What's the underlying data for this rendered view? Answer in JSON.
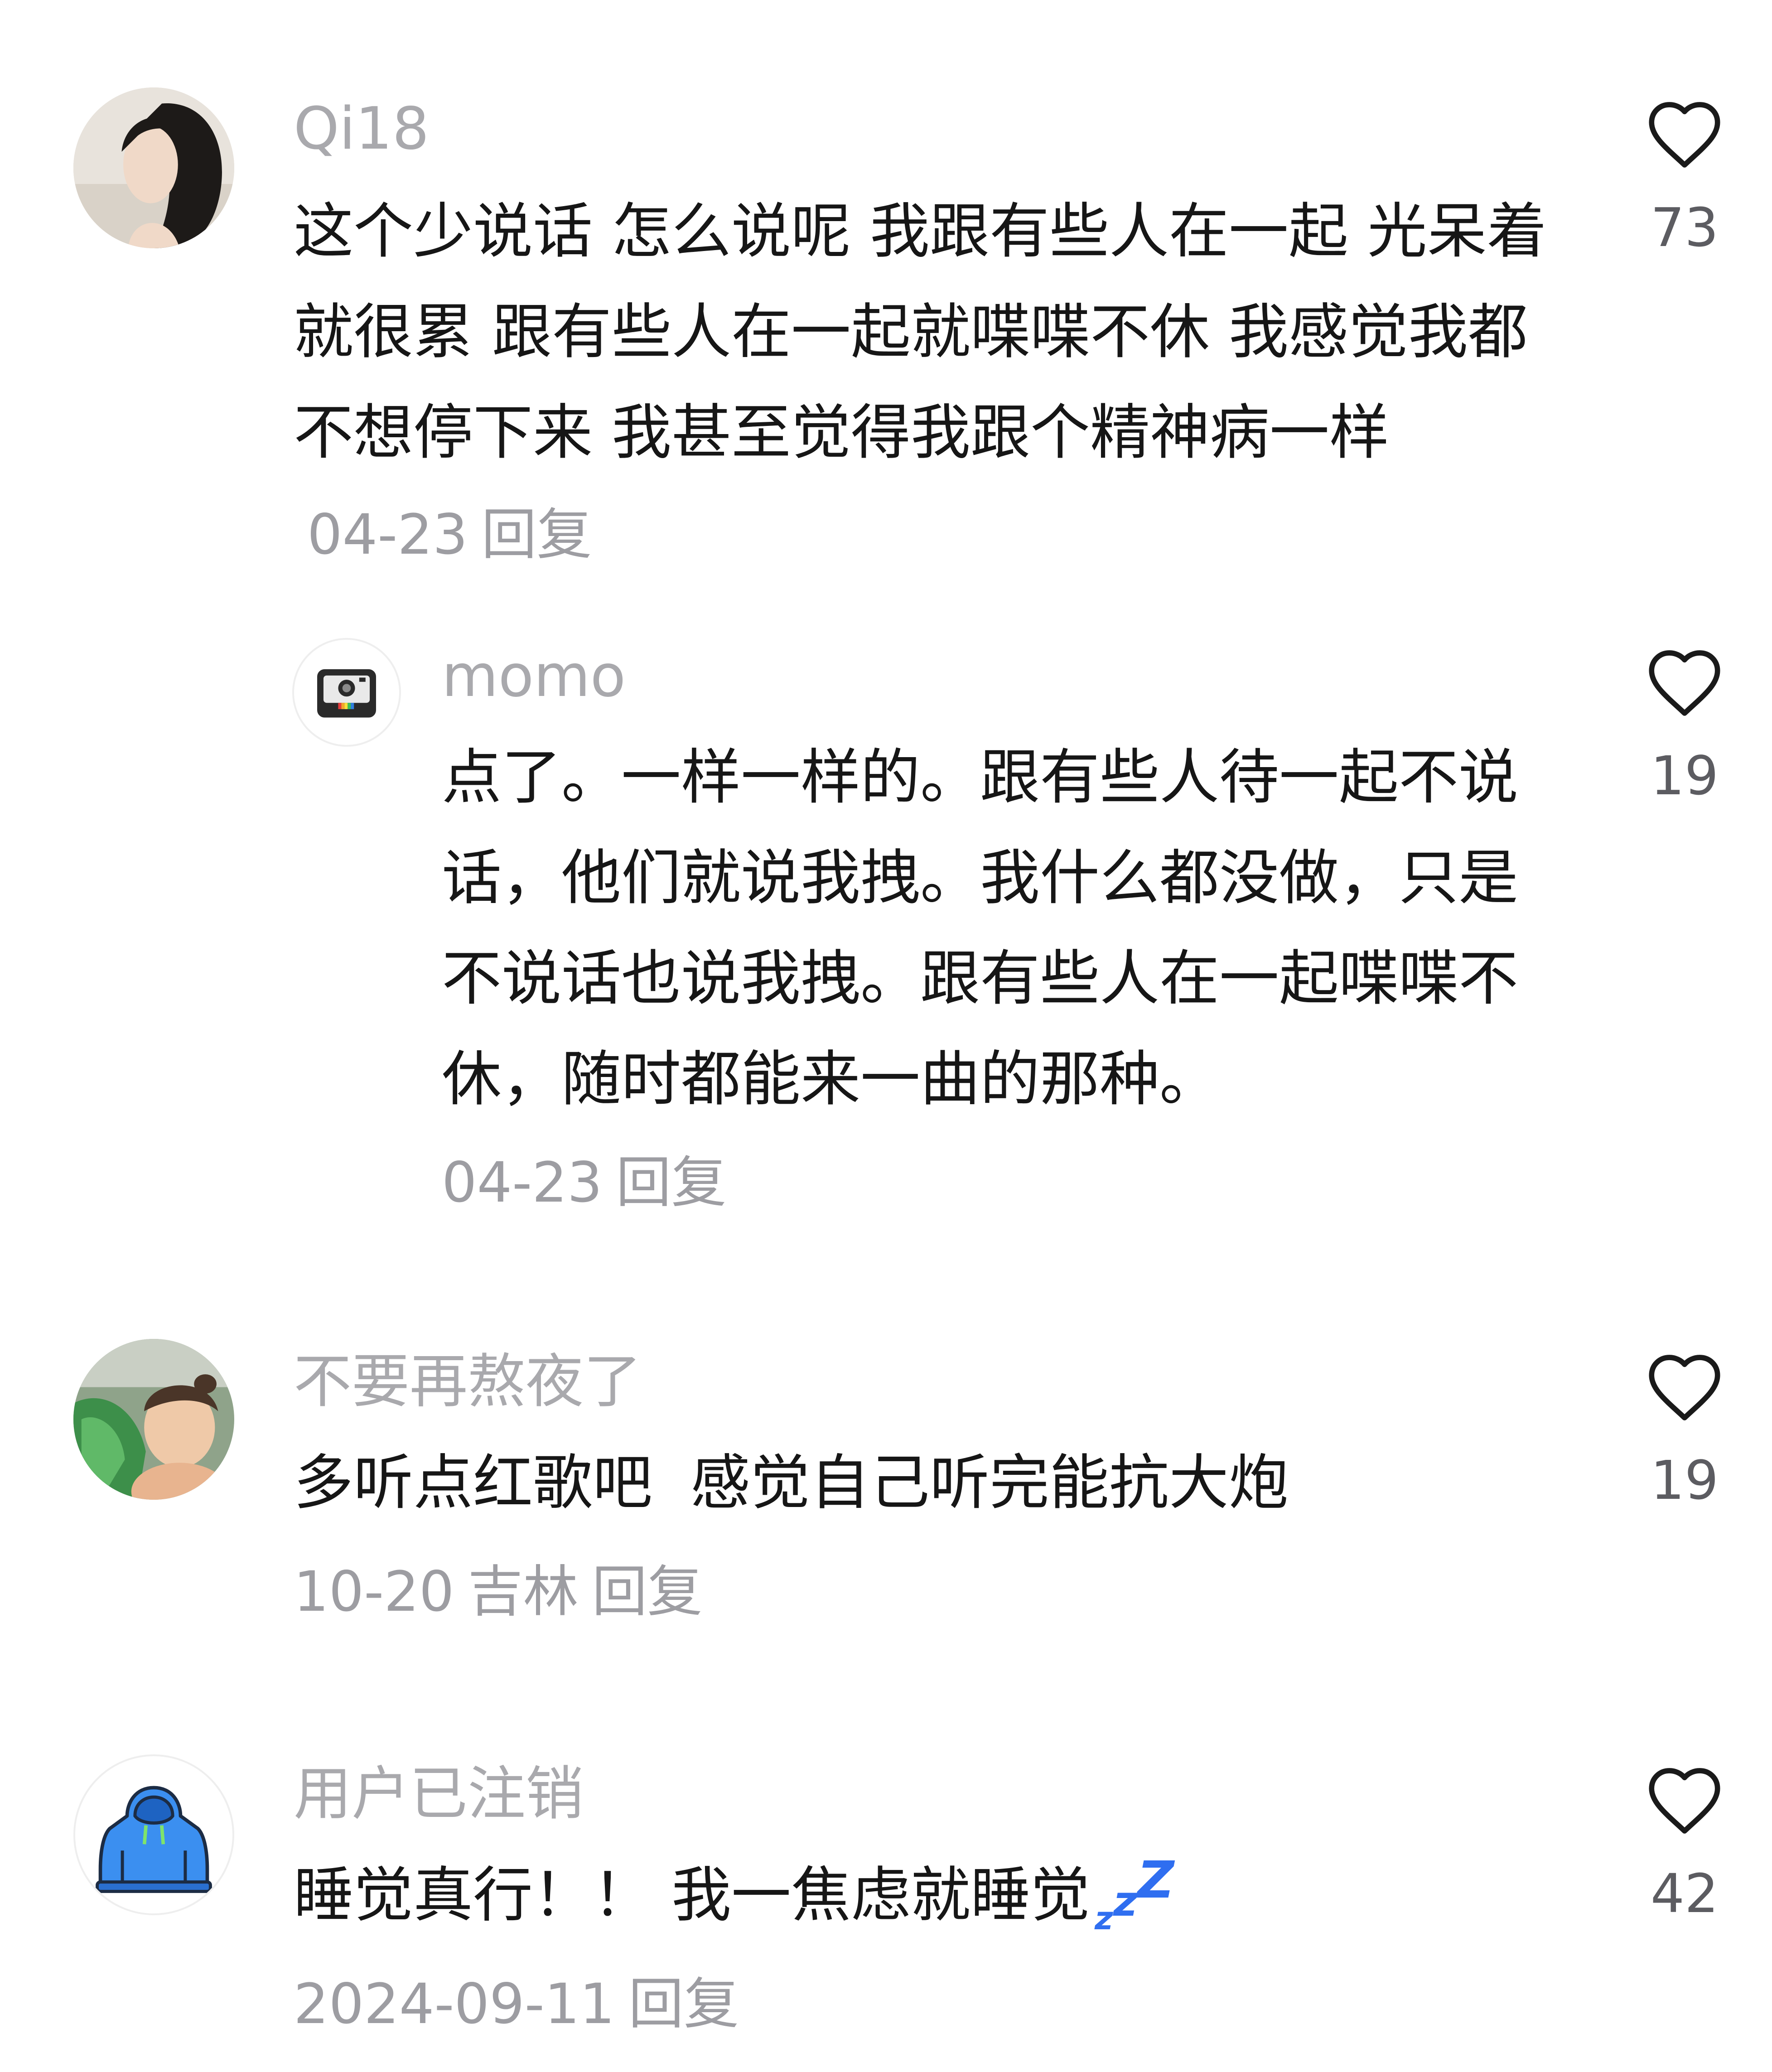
{
  "comments": [
    {
      "username": "Qi18",
      "text": "这个少说话 怎么说呢 我跟有些人在一起 光呆着就很累 跟有些人在一起就喋喋不休 我感觉我都不想停下来 我甚至觉得我跟个精神病一样",
      "date": "04-23",
      "reply_label": "回复",
      "likes": "73"
    },
    {
      "username": "momo",
      "text": "点了。一样一样的。跟有些人待一起不说话，他们就说我拽。我什么都没做，只是不说话也说我拽。跟有些人在一起喋喋不休，随时都能来一曲的那种。",
      "date": "04-23",
      "reply_label": "回复",
      "likes": "19"
    },
    {
      "username": "不要再熬夜了",
      "text": "多听点红歌吧  感觉自己听完能抗大炮",
      "date": "10-20",
      "location": "吉林",
      "reply_label": "回复",
      "likes": "19"
    },
    {
      "username": "用户已注销",
      "text": "睡觉真行！！ 我一焦虑就睡觉",
      "emoji": "zzz",
      "date": "2024-09-11",
      "reply_label": "回复",
      "likes": "42"
    }
  ],
  "colors": {
    "text": "#161616",
    "username": "#a9a9ad",
    "meta": "#9d9da2",
    "like_count": "#5c5c61",
    "heart_stroke": "#1a1a1a",
    "zzz": "#2f6ef0",
    "hoodie": "#3b8ff0"
  }
}
